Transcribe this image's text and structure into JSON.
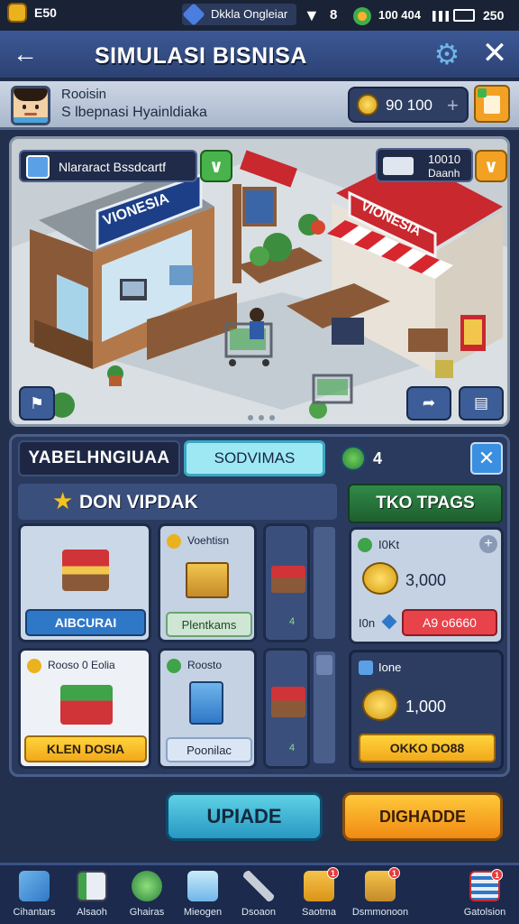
{
  "status_bar": {
    "time": "E50",
    "center_text": "Dkkla Ongleiar",
    "battery_text": "100 404",
    "right_value": "250"
  },
  "header": {
    "title": "SIMULASI BISNISA"
  },
  "profile": {
    "name": "Rooisin",
    "subtitle": "S lbepnasi Hyainldiaka",
    "coins": "90 100",
    "add_symbol": "+"
  },
  "scene": {
    "left_tag": "Nlararact Bssdcartf",
    "right_tag_line1": "10010",
    "right_tag_line2": "Daanh",
    "left_store_sign": "VIONESIA",
    "right_store_sign": "VIONESIA",
    "pagination_dots": 3
  },
  "panel": {
    "tab_active_label": "YABELHNGIUAA",
    "tab_second_label": "SODVIMAS",
    "tab_count": "4",
    "section_title": "DON VIPDAK",
    "section_right_title": "TKO TPAGS",
    "items": [
      {
        "label": "",
        "button": "AIBCURAI"
      },
      {
        "label": "Voehtisn",
        "button": "Plentkams"
      },
      {
        "label": "",
        "button": ""
      },
      {
        "label": "Rooso 0 Eolia",
        "button": "KLEN DOSIA"
      },
      {
        "label": "Roosto",
        "button": "Poonilac"
      },
      {
        "label": "",
        "button": ""
      }
    ],
    "offers": [
      {
        "label": "I0Kt",
        "amount": "3,000",
        "small_label": "I0n",
        "button": "A9 o6660"
      },
      {
        "label": "Ione",
        "amount": "1,000",
        "button": "OKKO DO88"
      }
    ],
    "mini_count_1": "4",
    "mini_count_2": "4"
  },
  "actions": {
    "primary": "UPIADE",
    "secondary": "DIGHADDE"
  },
  "nav": [
    {
      "label": "Cihantars",
      "icon": "wrench-icon"
    },
    {
      "label": "Alsaoh",
      "icon": "book-icon"
    },
    {
      "label": "Ghairas",
      "icon": "gem-icon"
    },
    {
      "label": "Mieogen",
      "icon": "box-icon"
    },
    {
      "label": "Dsoaon",
      "icon": "tools-icon"
    },
    {
      "label": "Saotma",
      "icon": "mail-icon",
      "badge": "1"
    },
    {
      "label": "Dsmmonoon",
      "icon": "chest-icon",
      "badge": "1"
    },
    {
      "label": "Gatolsion",
      "icon": "list-icon",
      "badge": "1"
    }
  ],
  "colors": {
    "accent": "#f2a81b",
    "primary": "#2f78c7",
    "danger": "#e8424b",
    "header": "#3c5896"
  }
}
